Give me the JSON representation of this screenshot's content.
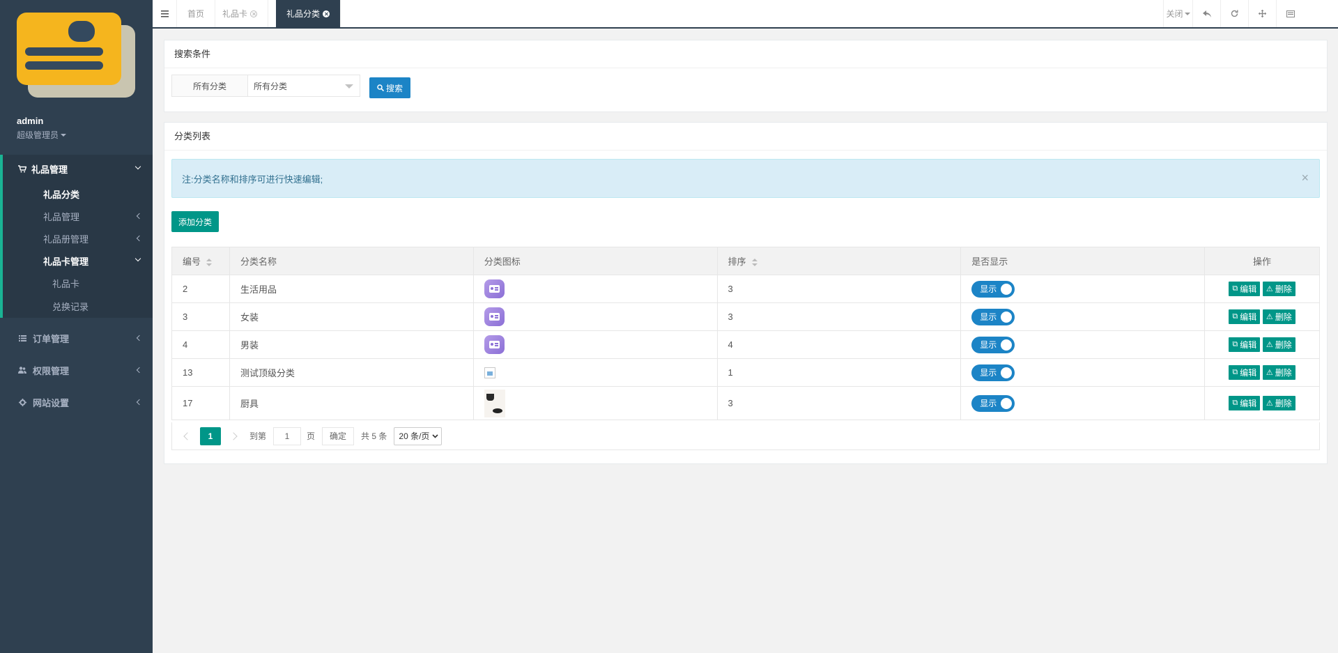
{
  "user": {
    "name": "admin",
    "role": "超级管理员"
  },
  "sidebar": {
    "group": "礼品管理",
    "sub_items": [
      {
        "label": "礼品分类"
      },
      {
        "label": "礼品管理"
      },
      {
        "label": "礼品册管理"
      },
      {
        "label": "礼品卡管理"
      }
    ],
    "card_children": [
      {
        "label": "礼品卡"
      },
      {
        "label": "兑换记录"
      }
    ],
    "other_groups": [
      {
        "label": "订单管理",
        "icon": "list-icon"
      },
      {
        "label": "权限管理",
        "icon": "users-icon"
      },
      {
        "label": "网站设置",
        "icon": "gear-icon"
      }
    ]
  },
  "tabs": [
    {
      "label": "首页"
    },
    {
      "label": "礼品卡"
    },
    {
      "label": "礼品分类"
    }
  ],
  "topbar": {
    "close_label": "关闭"
  },
  "search": {
    "title": "搜索条件",
    "label": "所有分类",
    "select_value": "所有分类",
    "button": "搜索"
  },
  "list": {
    "title": "分类列表",
    "notice": "注:分类名称和排序可进行快速编辑;",
    "add_button": "添加分类",
    "columns": {
      "id": "编号",
      "name": "分类名称",
      "icon": "分类图标",
      "sort": "排序",
      "show": "是否显示",
      "op": "操作"
    },
    "rows": [
      {
        "id": "2",
        "name": "生活用品",
        "sort": "3",
        "show": "显示"
      },
      {
        "id": "3",
        "name": "女装",
        "sort": "3",
        "show": "显示"
      },
      {
        "id": "4",
        "name": "男装",
        "sort": "4",
        "show": "显示"
      },
      {
        "id": "13",
        "name": "测试顶级分类",
        "sort": "1",
        "show": "显示"
      },
      {
        "id": "17",
        "name": "厨具",
        "sort": "3",
        "show": "显示"
      }
    ],
    "edit_label": "编辑",
    "delete_label": "删除"
  },
  "pager": {
    "current_page": "1",
    "goto_prefix": "到第",
    "goto_value": "1",
    "goto_suffix": "页",
    "ok": "确定",
    "total": "共 5 条",
    "page_size": "20 条/页"
  },
  "colors": {
    "sidebar_bg": "#2f4050",
    "accent_teal": "#009688",
    "accent_blue": "#1c84c6"
  }
}
